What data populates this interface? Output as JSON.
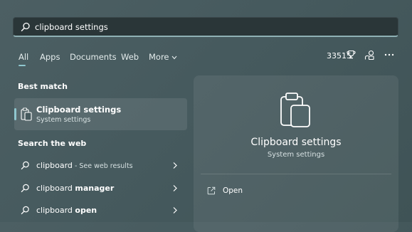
{
  "search": {
    "query_bold": "clipboard",
    "query_rest": " settings"
  },
  "tabs": [
    {
      "label": "All",
      "active": true
    },
    {
      "label": "Apps"
    },
    {
      "label": "Documents"
    },
    {
      "label": "Web"
    },
    {
      "label": "More"
    }
  ],
  "header": {
    "points": "33515"
  },
  "best_match": {
    "section_title": "Best match",
    "title": "Clipboard settings",
    "subtitle": "System settings"
  },
  "web": {
    "section_title": "Search the web",
    "items": [
      {
        "prefix": "clipboard",
        "bold": "",
        "hint": " - See web results"
      },
      {
        "prefix": "clipboard ",
        "bold": "manager",
        "hint": ""
      },
      {
        "prefix": "clipboard ",
        "bold": "open",
        "hint": ""
      }
    ]
  },
  "preview": {
    "title": "Clipboard settings",
    "subtitle": "System settings",
    "actions": [
      {
        "label": "Open",
        "icon": "open-external-icon"
      }
    ]
  },
  "colors": {
    "accent": "#8fc7cf",
    "background": "#4a5d61",
    "search_background": "#2a3638"
  }
}
